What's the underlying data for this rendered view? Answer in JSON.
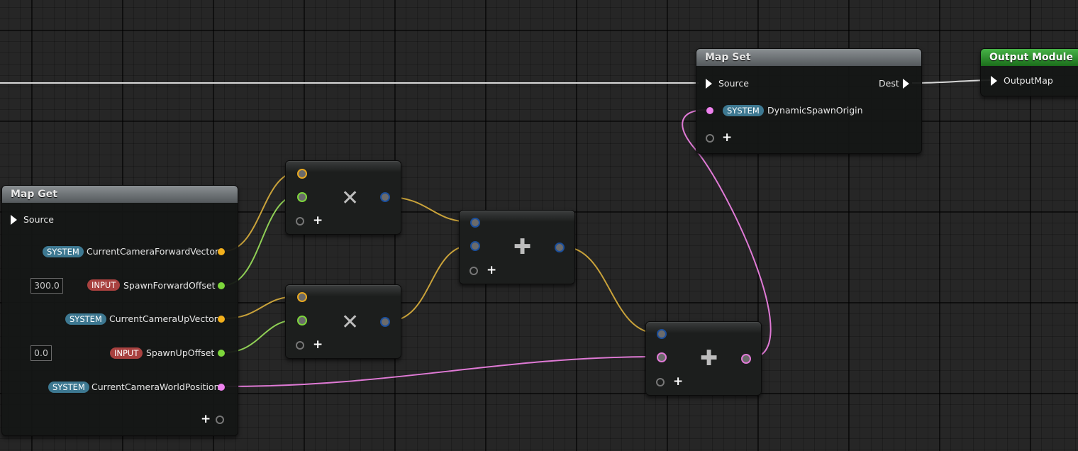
{
  "map_get": {
    "title": "Map Get",
    "source_label": "Source",
    "pins": [
      {
        "badge": "SYSTEM",
        "name": "CurrentCameraForwardVector",
        "value": ""
      },
      {
        "badge": "INPUT",
        "name": "SpawnForwardOffset",
        "value": "300.0"
      },
      {
        "badge": "SYSTEM",
        "name": "CurrentCameraUpVector",
        "value": ""
      },
      {
        "badge": "INPUT",
        "name": "SpawnUpOffset",
        "value": "0.0"
      },
      {
        "badge": "SYSTEM",
        "name": "CurrentCameraWorldPosition",
        "value": ""
      }
    ],
    "add_symbol": "+"
  },
  "multiply_ops": [
    {
      "symbol": "✕",
      "add_symbol": "+"
    },
    {
      "symbol": "✕",
      "add_symbol": "+"
    }
  ],
  "add_ops": [
    {
      "symbol": "✚",
      "add_symbol": "+"
    },
    {
      "symbol": "✚",
      "add_symbol": "+"
    }
  ],
  "map_set": {
    "title": "Map Set",
    "source_label": "Source",
    "dest_label": "Dest",
    "pin": {
      "badge": "SYSTEM",
      "name": "DynamicSpawnOrigin"
    },
    "add_symbol": "+"
  },
  "output_module": {
    "title": "Output Module",
    "pin_label": "OutputMap"
  },
  "colors": {
    "vector_pin": "#f3b01c",
    "float_pin": "#7dd63b",
    "position_pin": "#ee82ee",
    "result_pin": "#1b4f9c",
    "system_badge": "#3d7891",
    "input_badge": "#a8413f",
    "output_header": "#2f9a2f"
  }
}
